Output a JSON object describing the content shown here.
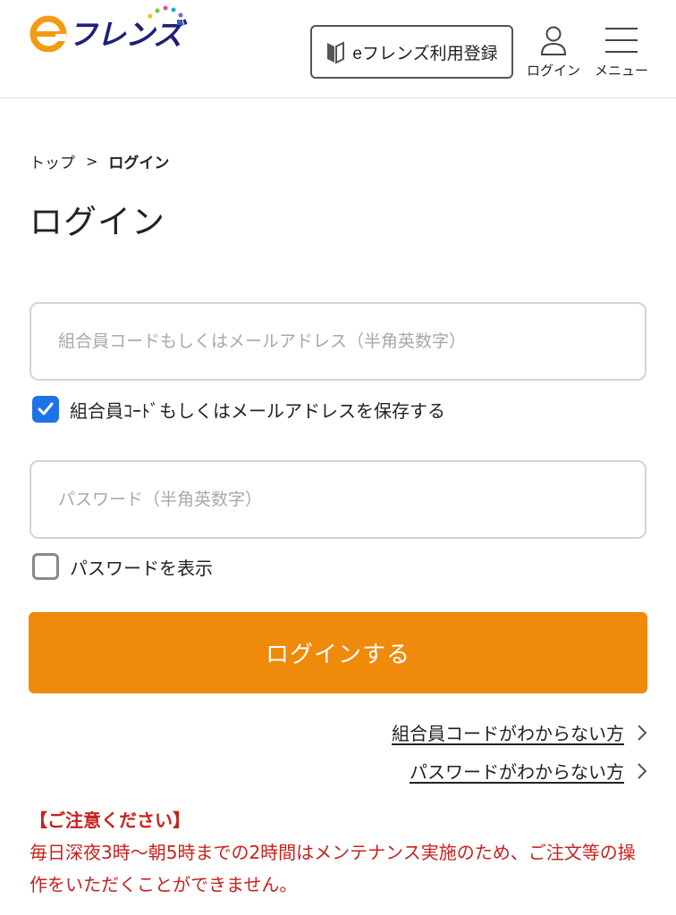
{
  "header": {
    "logo_text": "フレンズ",
    "register_label": "eフレンズ利用登録",
    "login_label": "ログイン",
    "menu_label": "メニュー"
  },
  "breadcrumb": {
    "home": "トップ",
    "separator": ">",
    "current": "ログイン"
  },
  "page_title": "ログイン",
  "form": {
    "user_placeholder": "組合員コードもしくはメールアドレス（半角英数字）",
    "user_value": "",
    "save_label": "組合員ｺｰﾄﾞもしくはメールアドレスを保存する",
    "save_checked": true,
    "password_placeholder": "パスワード（半角英数字）",
    "password_value": "",
    "show_password_label": "パスワードを表示",
    "show_password_checked": false,
    "submit_label": "ログインする"
  },
  "help_links": {
    "forgot_code": "組合員コードがわからない方",
    "forgot_password": "パスワードがわからない方"
  },
  "notice": {
    "title": "【ご注意ください】",
    "body": "毎日深夜3時〜朝5時までの2時間はメンテナンス実施のため、ご注文等の操作をいただくことができません。"
  },
  "colors": {
    "accent": "#ef8a0b",
    "checkbox": "#1e73e8",
    "notice": "#c8211e"
  }
}
